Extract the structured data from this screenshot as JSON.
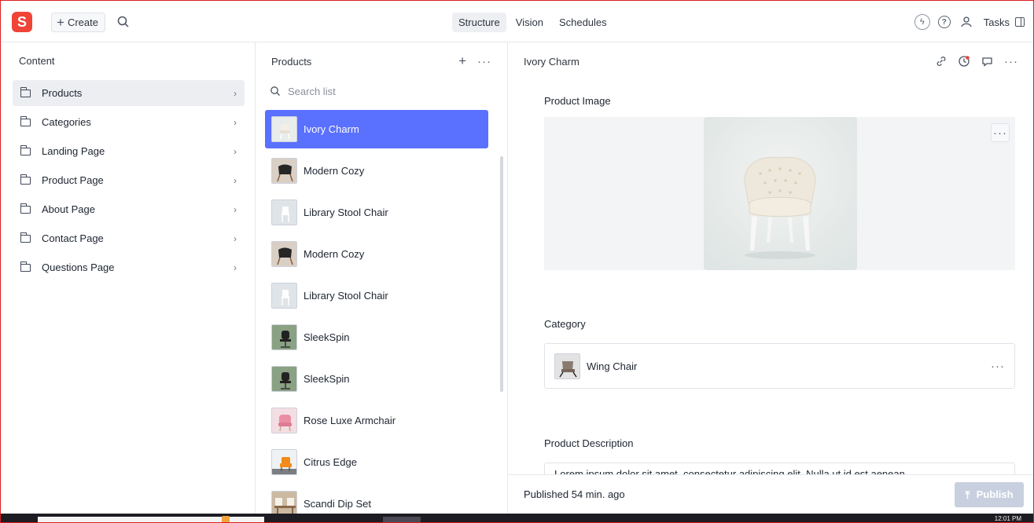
{
  "app": {
    "logo_letter": "S",
    "brand_color": "#f04438"
  },
  "topbar": {
    "create_label": "Create",
    "tabs": [
      "Structure",
      "Vision",
      "Schedules"
    ],
    "active_tab": "Structure",
    "tasks_label": "Tasks"
  },
  "content_pane": {
    "title": "Content",
    "items": [
      {
        "label": "Products",
        "selected": true
      },
      {
        "label": "Categories"
      },
      {
        "label": "Landing Page"
      },
      {
        "label": "Product Page"
      },
      {
        "label": "About Page"
      },
      {
        "label": "Contact Page"
      },
      {
        "label": "Questions Page"
      }
    ]
  },
  "products_pane": {
    "title": "Products",
    "search_placeholder": "Search list",
    "items": [
      {
        "label": "Ivory Charm",
        "selected": true
      },
      {
        "label": "Modern Cozy"
      },
      {
        "label": "Library Stool Chair"
      },
      {
        "label": "Modern Cozy"
      },
      {
        "label": "Library Stool Chair"
      },
      {
        "label": "SleekSpin"
      },
      {
        "label": "SleekSpin"
      },
      {
        "label": "Rose Luxe Armchair"
      },
      {
        "label": "Citrus Edge"
      },
      {
        "label": "Scandi Dip Set"
      }
    ],
    "selected_color": "#5a70ff"
  },
  "document": {
    "title": "Ivory Charm",
    "product_image_label": "Product Image",
    "category_label": "Category",
    "category_value": "Wing Chair",
    "description_label": "Product Description",
    "description_partial": "Lorem ipsum dolor sit amet, consectetur adipiscing elit. Nulla ut id est aenean",
    "footer_status": "Published 54 min. ago",
    "publish_label": "Publish"
  },
  "taskbar": {
    "time": "12:01 PM"
  }
}
